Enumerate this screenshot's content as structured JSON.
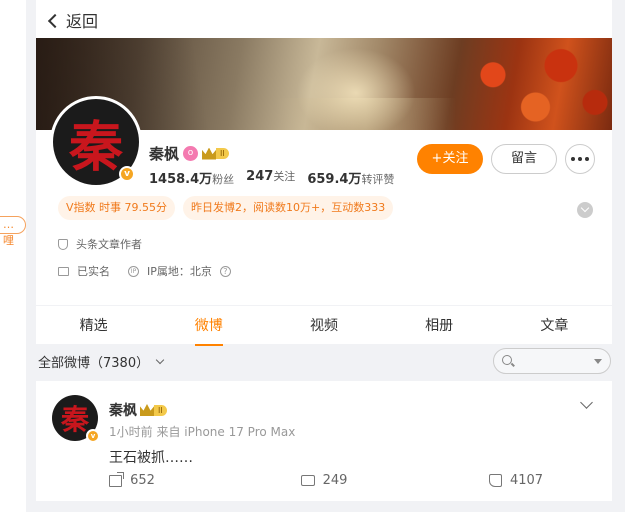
{
  "left_tag": "…哩",
  "header": {
    "back_label": "返回"
  },
  "profile": {
    "name": "秦枫",
    "seal_char": "秦",
    "v_badge": "v",
    "pink_badge": "o",
    "level_badge": "II",
    "stats": [
      {
        "value": "1458.4万",
        "label": "粉丝"
      },
      {
        "value": "247",
        "label": "关注"
      },
      {
        "value": "659.4万",
        "label": "转评赞"
      }
    ],
    "follow_label": "+关注",
    "message_label": "留言",
    "tags": [
      "V指数 时事 79.55分",
      "昨日发博2，阅读数10万+，互动数333"
    ],
    "role": "头条文章作者",
    "verified": "已实名",
    "ip_label": "IP属地：北京",
    "ip_icon": "IP",
    "help_icon": "?"
  },
  "tabs": [
    {
      "label": "精选",
      "active": false
    },
    {
      "label": "微博",
      "active": true
    },
    {
      "label": "视频",
      "active": false
    },
    {
      "label": "相册",
      "active": false
    },
    {
      "label": "文章",
      "active": false
    }
  ],
  "filter": {
    "label": "全部微博（7380）"
  },
  "post": {
    "name": "秦枫",
    "level_badge": "II",
    "meta": "1小时前 来自 iPhone 17 Pro Max",
    "text": "王石被抓……",
    "forward_count": "652",
    "comment_count": "249",
    "like_count": "4107"
  },
  "colors": {
    "accent": "#ff8200",
    "tag_text": "#f07a1c",
    "seal_red": "#c8161d"
  }
}
